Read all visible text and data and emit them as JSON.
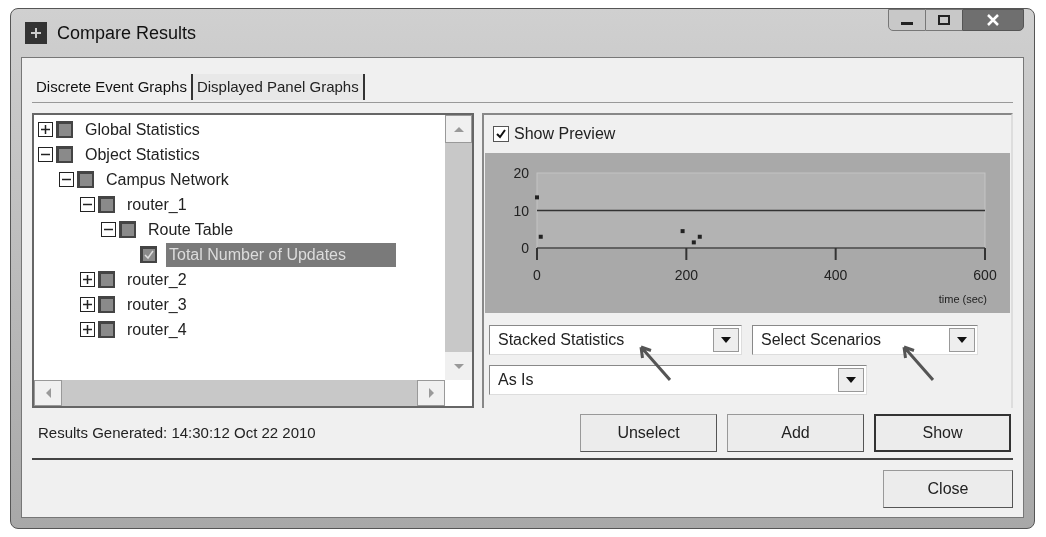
{
  "window": {
    "title": "Compare Results"
  },
  "tabs": [
    {
      "label": "Discrete Event Graphs",
      "selected": true
    },
    {
      "label": "Displayed Panel Graphs",
      "selected": false
    }
  ],
  "tree": [
    {
      "label": "Global Statistics",
      "expanded": false,
      "selected": false
    },
    {
      "label": "Object Statistics",
      "expanded": true,
      "selected": false,
      "children": [
        {
          "label": "Campus Network",
          "expanded": true,
          "selected": false,
          "children": [
            {
              "label": "router_1",
              "expanded": true,
              "selected": false,
              "children": [
                {
                  "label": "Route Table",
                  "expanded": true,
                  "selected": false,
                  "children": [
                    {
                      "label": "Total Number of Updates",
                      "selected": true,
                      "checked": true
                    }
                  ]
                }
              ]
            },
            {
              "label": "router_2",
              "expanded": false,
              "selected": false
            },
            {
              "label": "router_3",
              "expanded": false,
              "selected": false
            },
            {
              "label": "router_4",
              "expanded": false,
              "selected": false
            }
          ]
        }
      ]
    }
  ],
  "preview": {
    "show_preview": {
      "label": "Show Preview",
      "checked": true
    },
    "chart_data": {
      "type": "scatter",
      "xlabel": "time (sec)",
      "xlim": [
        0,
        600
      ],
      "ylim": [
        0,
        20
      ],
      "xticks": [
        0,
        200,
        400,
        600
      ],
      "yticks": [
        0,
        10,
        20
      ],
      "x": [
        0,
        5,
        195,
        210,
        218
      ],
      "series": [
        {
          "color": "#222222",
          "values": [
            13.5,
            3,
            4.5,
            1.5,
            3
          ]
        }
      ]
    }
  },
  "dropdowns": [
    {
      "value": "Stacked Statistics",
      "pointer": true
    },
    {
      "value": "Select Scenarios",
      "pointer": true
    },
    {
      "value": "As Is",
      "pointer": false
    }
  ],
  "status": "Results Generated: 14:30:12 Oct 22 2010",
  "buttons": [
    {
      "label": "Unselect",
      "default": false
    },
    {
      "label": "Add",
      "default": false
    },
    {
      "label": "Show",
      "default": true
    }
  ],
  "close_button": "Close"
}
